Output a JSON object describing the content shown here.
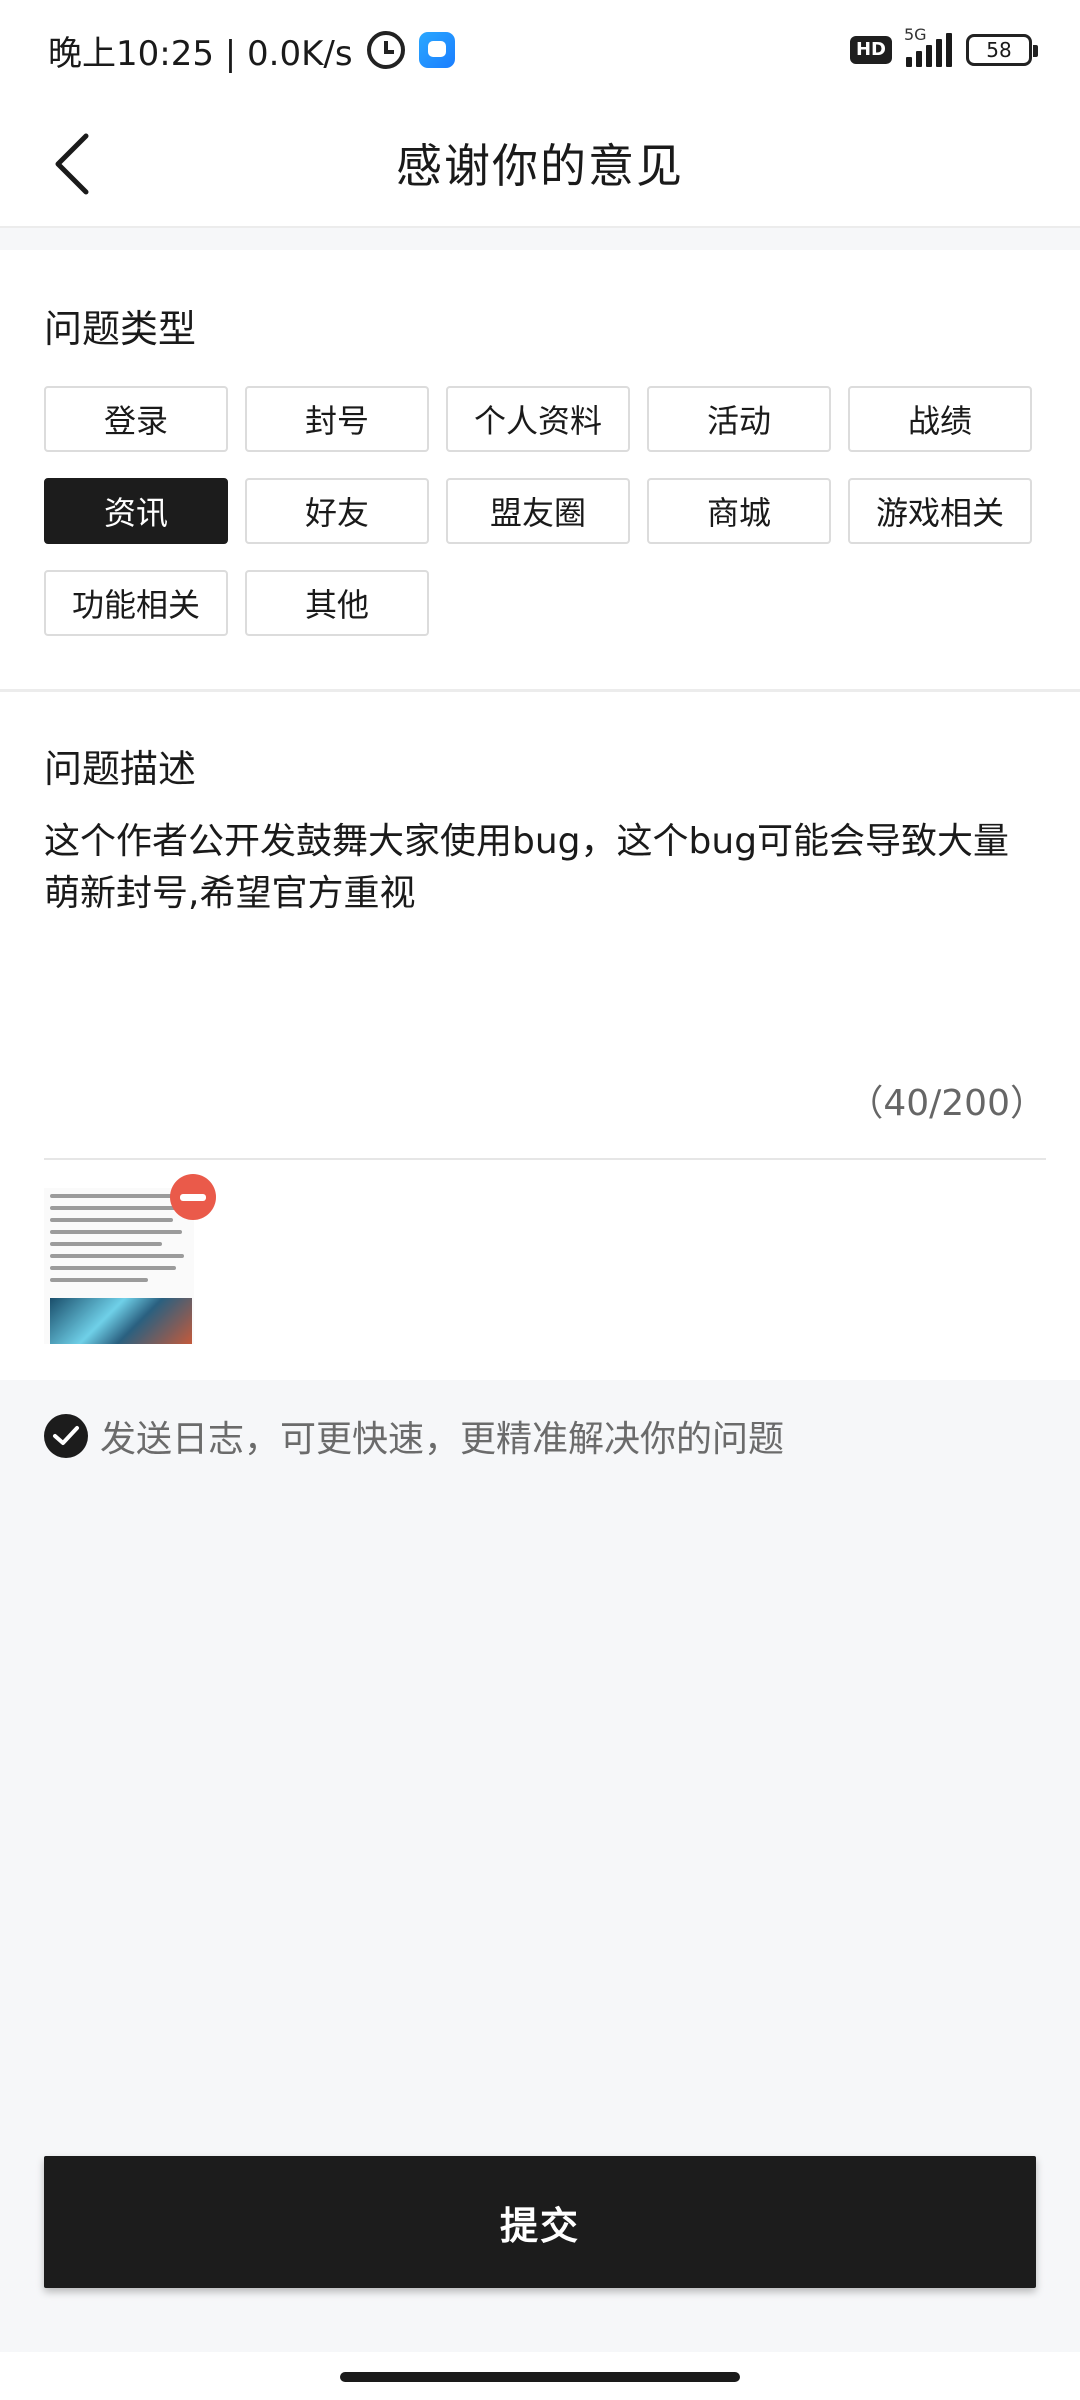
{
  "status_bar": {
    "time_text": "晚上10:25 | 0.0K/s",
    "hd_label": "HD",
    "network_label": "5G",
    "battery_level": "58",
    "icons": [
      "alarm-icon",
      "app-badge-icon",
      "signal-icon",
      "battery-icon"
    ]
  },
  "header": {
    "title": "感谢你的意见",
    "back_icon": "chevron-left-icon"
  },
  "problem_type": {
    "title": "问题类型",
    "selected": "资讯",
    "tags": [
      {
        "label": "登录"
      },
      {
        "label": "封号"
      },
      {
        "label": "个人资料"
      },
      {
        "label": "活动"
      },
      {
        "label": "战绩"
      },
      {
        "label": "资讯"
      },
      {
        "label": "好友"
      },
      {
        "label": "盟友圈"
      },
      {
        "label": "商城"
      },
      {
        "label": "游戏相关"
      },
      {
        "label": "功能相关"
      },
      {
        "label": "其他"
      }
    ]
  },
  "problem_description": {
    "title": "问题描述",
    "text": "这个作者公开发鼓舞大家使用bug，这个bug可能会导致大量萌新封号,希望官方重视",
    "counter": "（40/200）"
  },
  "attachment": {
    "remove_icon": "minus-circle-icon"
  },
  "log_option": {
    "checked": true,
    "label": "发送日志，可更快速，更精准解决你的问题"
  },
  "submit": {
    "label": "提交"
  },
  "colors": {
    "accent_dark": "#1c1c1c",
    "remove_red": "#ea5a4a",
    "page_bg": "#f6f7f9"
  }
}
